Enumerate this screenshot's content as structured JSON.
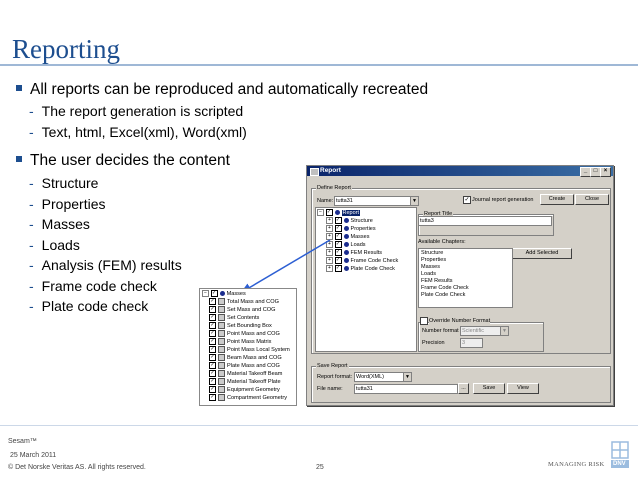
{
  "slide": {
    "title": "Reporting",
    "bullets": [
      {
        "text": "All reports can be reproduced and automatically recreated",
        "sub": [
          "The report generation is scripted",
          "Text, html, Excel(xml), Word(xml)"
        ]
      },
      {
        "text": "The user decides the content",
        "sub": [
          "Structure",
          "Properties",
          "Masses",
          "Loads",
          "Analysis (FEM) results",
          "Frame code check",
          "Plate code check"
        ]
      }
    ]
  },
  "footer": {
    "product": "Sesam™",
    "date": "25 March 2011",
    "copyright": "© Det Norske Veritas AS. All rights reserved.",
    "page": "25",
    "tagline": "MANAGING RISK",
    "logo_text": "DNV",
    "brand_color": "#1d4e8f",
    "logo_color": "#9bbcdf"
  },
  "dialog": {
    "title": "Report",
    "define_group": "Define Report",
    "name_label": "Name:",
    "name_value": "tutta31",
    "journal_label": "Journal report generation",
    "journal_checked": true,
    "create_button": "Create",
    "close_button": "Close",
    "tree_root": "Report",
    "tree_items": [
      "Structure",
      "Properties",
      "Masses",
      "Loads",
      "FEM Results",
      "Frame Code Check",
      "Plate Code Check"
    ],
    "report_title_label": "Report Title",
    "report_title_value": "tutta3",
    "available_label": "Available Chapters:",
    "add_selected_button": "Add Selected",
    "available_chapters": [
      "Structure",
      "Properties",
      "Masses",
      "Loads",
      "FEM Results",
      "Frame Code Check",
      "Plate Code Check"
    ],
    "override_label": "Override Number Format",
    "number_format_label": "Number format",
    "number_format_value": "Scientific",
    "precision_label": "Precision",
    "precision_value": "3",
    "save_group": "Save Report",
    "format_label": "Report format:",
    "format_value": "Word(XML)",
    "file_label": "File name:",
    "file_value": "tutta31",
    "browse_button": "...",
    "save_button": "Save",
    "view_button": "View"
  },
  "popup": {
    "root": "Masses",
    "items": [
      "Total Mass and COG",
      "Set Mass and COG",
      "Set Contents",
      "Set Bounding Box",
      "Point Mass and COG",
      "Point Mass Matrix",
      "Point Mass Local System",
      "Beam Mass and COG",
      "Plate Mass and COG",
      "Material Takeoff Beam",
      "Material Takeoff Plate",
      "Equipment Geometry",
      "Compartment Geometry"
    ]
  },
  "arrow_color": "#2d5fd3"
}
